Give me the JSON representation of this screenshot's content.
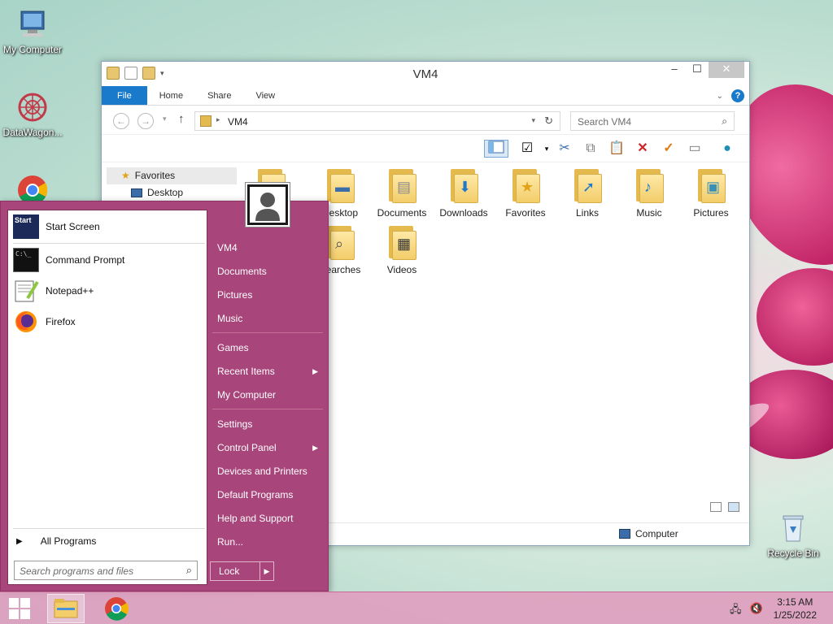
{
  "desktop": {
    "icons": [
      {
        "label": "My Computer"
      },
      {
        "label": "DataWagon..."
      },
      {
        "label": "Recycle Bin"
      }
    ]
  },
  "explorer": {
    "title": "VM4",
    "tabs": [
      "File",
      "Home",
      "Share",
      "View"
    ],
    "address": "VM4",
    "search_placeholder": "Search VM4",
    "nav_pane": [
      {
        "label": "Favorites"
      },
      {
        "label": "Desktop"
      }
    ],
    "folders": [
      {
        "label": "Desktop"
      },
      {
        "label": "Documents"
      },
      {
        "label": "Downloads"
      },
      {
        "label": "Favorites"
      },
      {
        "label": "Links"
      },
      {
        "label": "Music"
      },
      {
        "label": "Pictures"
      },
      {
        "label": "Searches"
      },
      {
        "label": "Videos"
      }
    ],
    "status_location": "Computer"
  },
  "start_menu": {
    "pinned": [
      {
        "label": "Start Screen",
        "icon_text": "Start"
      },
      {
        "label": "Command Prompt",
        "icon_text": "C:\\_"
      },
      {
        "label": "Notepad++"
      },
      {
        "label": "Firefox"
      }
    ],
    "all_programs": "All Programs",
    "search_placeholder": "Search programs and files",
    "right_items": [
      {
        "label": "VM4"
      },
      {
        "label": "Documents"
      },
      {
        "label": "Pictures"
      },
      {
        "label": "Music"
      },
      {
        "label": "Games"
      },
      {
        "label": "Recent Items"
      },
      {
        "label": "My Computer"
      },
      {
        "label": "Settings"
      },
      {
        "label": "Control Panel"
      },
      {
        "label": "Devices and Printers"
      },
      {
        "label": "Default Programs"
      },
      {
        "label": "Help and Support"
      },
      {
        "label": "Run..."
      }
    ],
    "lock_label": "Lock"
  },
  "taskbar": {
    "time": "3:15 AM",
    "date": "1/25/2022"
  },
  "colors": {
    "start_menu_bg": "#a8457a",
    "ribbon_file_tab": "#1979ca",
    "taskbar": "#e09cbe"
  }
}
